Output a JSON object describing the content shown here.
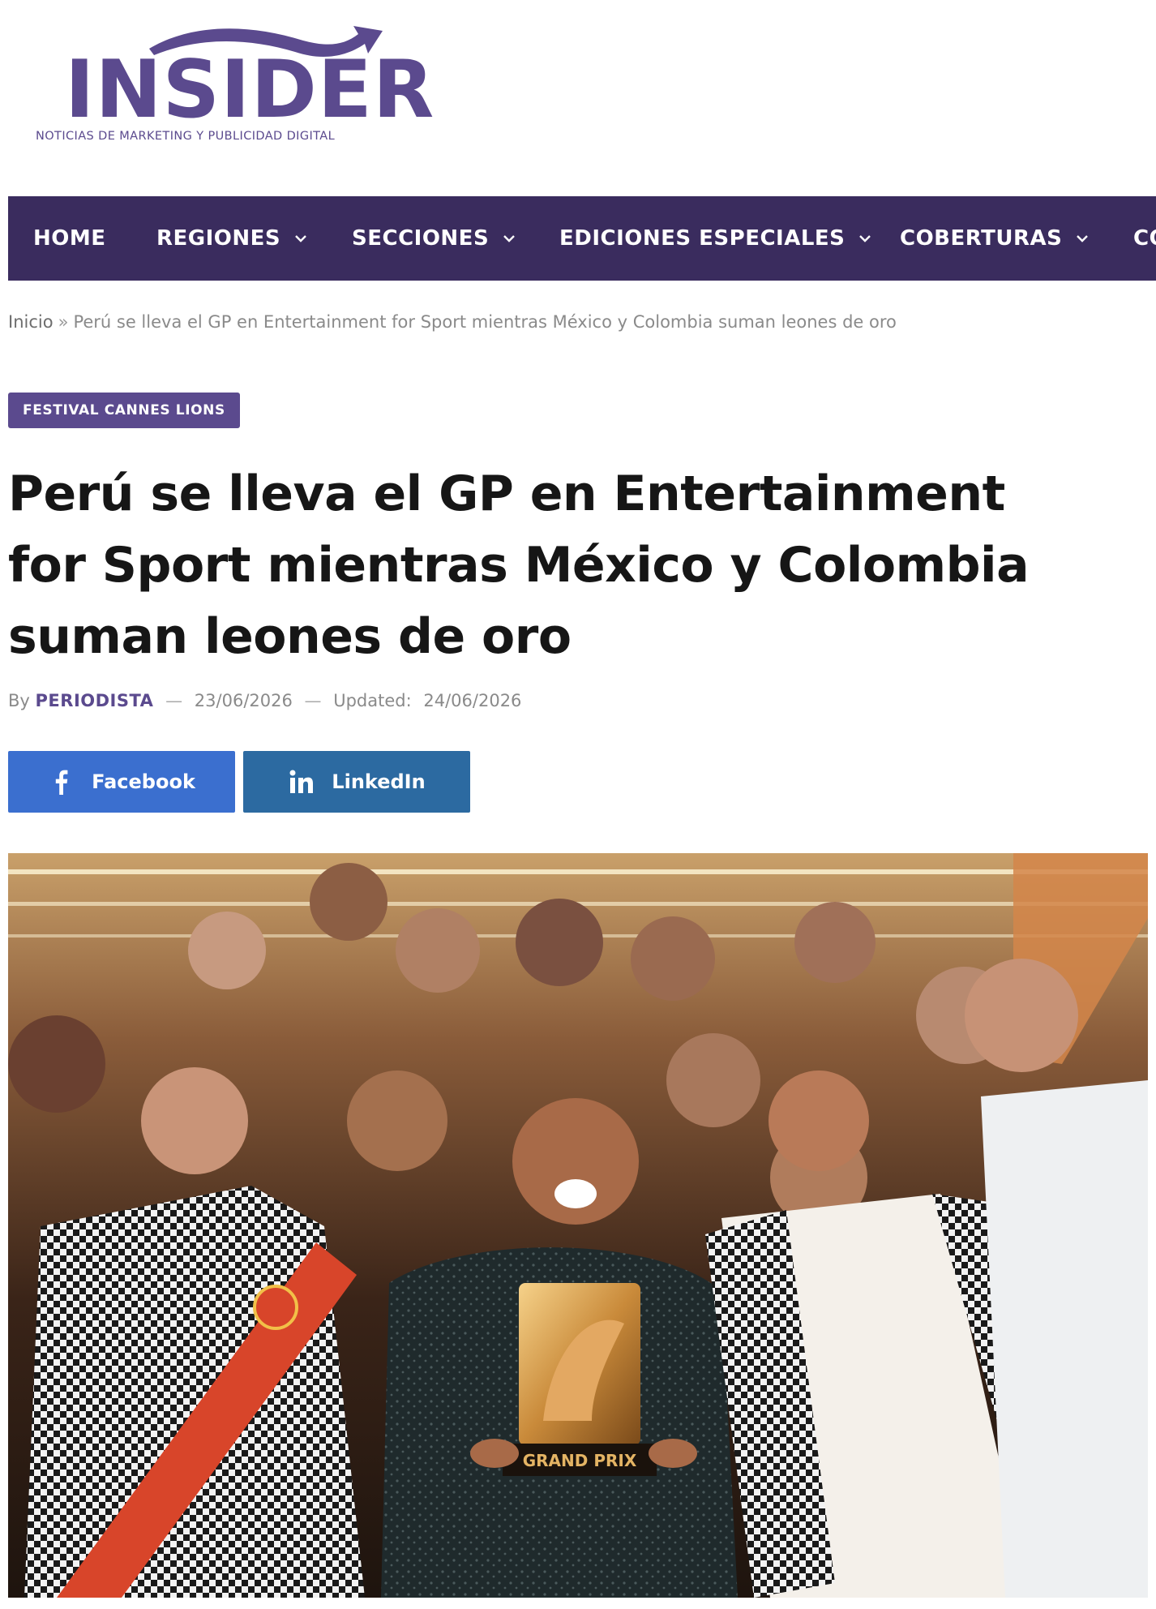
{
  "site": {
    "logo_text": "INSIDER",
    "tagline": "NOTICIAS DE MARKETING Y PUBLICIDAD DIGITAL",
    "brand_color": "#5b4a8e",
    "nav_color": "#3a2c5e"
  },
  "nav": {
    "items": [
      {
        "label": "HOME",
        "has_dropdown": false
      },
      {
        "label": "REGIONES",
        "has_dropdown": true
      },
      {
        "label": "SECCIONES",
        "has_dropdown": true
      },
      {
        "label": "EDICIONES ESPECIALES",
        "has_dropdown": true
      },
      {
        "label": "COBERTURAS",
        "has_dropdown": true
      },
      {
        "label": "CO",
        "has_dropdown": false
      }
    ]
  },
  "breadcrumb": {
    "home": "Inicio",
    "separator": "»",
    "current": "Perú se lleva el GP en Entertainment for Sport mientras México y Colombia suman leones de oro"
  },
  "article": {
    "category": "FESTIVAL CANNES LIONS",
    "title": "Perú se lleva el GP en Entertainment for Sport mientras México y Colombia suman leones de oro",
    "by_label": "By",
    "author": "PERIODISTA",
    "published": "23/06/2026",
    "updated_label": "Updated:",
    "updated": "24/06/2026",
    "hero_trophy_text": "GRAND PRIX"
  },
  "share": {
    "facebook": {
      "label": "Facebook",
      "icon": "facebook-icon",
      "color": "#3b6fcf"
    },
    "linkedin": {
      "label": "LinkedIn",
      "icon": "linkedin-icon",
      "color": "#2c6aa1"
    }
  }
}
